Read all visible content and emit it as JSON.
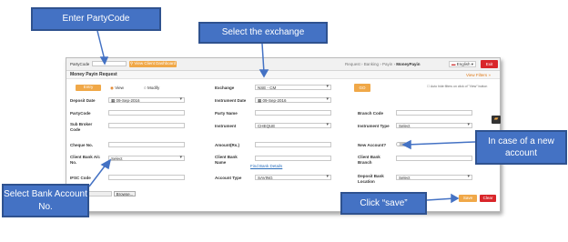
{
  "callouts": {
    "party_code": "Enter PartyCode",
    "exchange": "Select the exchange",
    "new_account": "In case of a new account",
    "bank_account": "Select Bank Account No.",
    "save": "Click “save”"
  },
  "topbar": {
    "party_code_label": "PartyCode",
    "view_dashboard": "View Client Dashboard",
    "breadcrumb": [
      "Request",
      "Banking",
      "Payin",
      "MoneyPayin"
    ],
    "language": "English",
    "exit": "Exit"
  },
  "panel": {
    "title": "Money Payin Request",
    "view_filters": "View Filters",
    "auto_hide": "Auto hide filters on click of \"View\" button"
  },
  "tabs": {
    "entry": "Entry",
    "view": "View",
    "modify": "Modify"
  },
  "go_label": "GO",
  "fields": {
    "exchange": {
      "label": "Exchange",
      "value": "NSE - CM"
    },
    "deposit_date": {
      "label": "Deposit Date",
      "value": "09-Sep-2016"
    },
    "instrument_date": {
      "label": "Instrument Date",
      "value": "09-Sep-2016"
    },
    "party_code": {
      "label": "PartyCode"
    },
    "party_name": {
      "label": "Party Name"
    },
    "branch_code": {
      "label": "Branch Code"
    },
    "sub_broker_code": {
      "label": "Sub Broker Code"
    },
    "instrument": {
      "label": "Instrument",
      "value": "CHEQUE"
    },
    "instrument_type": {
      "label": "Instrument Type",
      "value": "Select"
    },
    "cheque_no": {
      "label": "Cheque No."
    },
    "amount": {
      "label": "Amount(Rs.)"
    },
    "new_account": {
      "label": "New Account?"
    },
    "client_bank_ac": {
      "label": "Client Bank A/c No.",
      "value": "Select"
    },
    "client_bank_name": {
      "label": "Client Bank Name",
      "link": "Find Bank Details"
    },
    "client_bank_branch": {
      "label": "Client Bank Branch"
    },
    "ifsc_code": {
      "label": "IFSC Code"
    },
    "account_type": {
      "label": "Account Type",
      "value": "SAVING"
    },
    "deposit_bank": {
      "label": "Deposit Bank Location",
      "value": "Select"
    }
  },
  "browse_label": "Browse...",
  "save_label": "Save",
  "clear_label": "Clear",
  "colors": {
    "callout_fill": "#4472c4",
    "accent_orange": "#f0a848",
    "exit_red": "#d9262a"
  }
}
